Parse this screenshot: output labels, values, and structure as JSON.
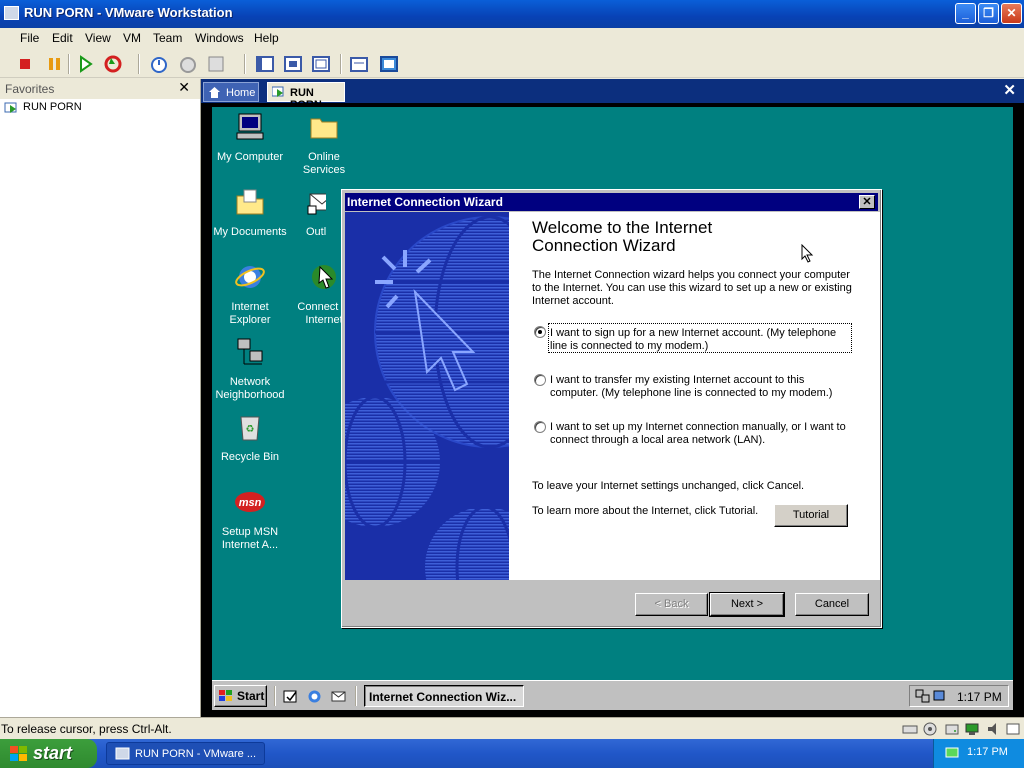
{
  "window": {
    "title": "RUN PORN - VMware Workstation"
  },
  "menu": [
    "File",
    "Edit",
    "View",
    "VM",
    "Team",
    "Windows",
    "Help"
  ],
  "favorites": {
    "header": "Favorites",
    "items": [
      "RUN PORN"
    ]
  },
  "tabs": {
    "home": "Home",
    "vm": "RUN PORN"
  },
  "desktop_icons": [
    {
      "label": "My Computer",
      "icon": "my-computer-icon"
    },
    {
      "label": "Online Services",
      "icon": "folder-icon"
    },
    {
      "label": "My Documents",
      "icon": "my-documents-icon"
    },
    {
      "label": "Outlook Express",
      "icon": "outlook-express-icon"
    },
    {
      "label": "Internet Explorer",
      "icon": "internet-explorer-icon"
    },
    {
      "label": "Connect to Internet",
      "icon": "connect-internet-icon"
    },
    {
      "label": "Network Neighborhood",
      "icon": "network-icon"
    },
    {
      "label": "Recycle Bin",
      "icon": "recycle-bin-icon"
    },
    {
      "label": "Setup MSN Internet A...",
      "icon": "msn-icon"
    }
  ],
  "wizard": {
    "title": "Internet Connection Wizard",
    "heading": "Welcome to the Internet Connection Wizard",
    "intro": "The Internet Connection wizard helps you connect your computer to the Internet.  You can use this wizard to set up a new or existing Internet account.",
    "options": [
      "I want to sign up for a new Internet account. (My telephone line is connected to my modem.)",
      "I want to transfer my existing Internet account to this computer. (My telephone line is connected to my modem.)",
      "I want to set up my Internet connection manually, or I want to connect through a local area network (LAN)."
    ],
    "selected_option": 0,
    "cancel_note": "To leave your Internet settings unchanged, click Cancel.",
    "tutorial_note": "To learn more about the Internet, click Tutorial.",
    "tutorial_button": "Tutorial",
    "back_button": "< Back",
    "next_button": "Next >",
    "cancel_button": "Cancel"
  },
  "vm_taskbar": {
    "start": "Start",
    "task": "Internet Connection Wiz...",
    "clock": "1:17 PM"
  },
  "status_bar": "To release cursor, press Ctrl-Alt.",
  "xp_taskbar": {
    "start": "start",
    "task": "RUN PORN - VMware ...",
    "clock": "1:17 PM"
  },
  "colors": {
    "xp_blue": "#0842b5",
    "vm_desktop": "#008080",
    "win98_titlebar": "#000080",
    "wizard_side": "#1a2fa8"
  }
}
